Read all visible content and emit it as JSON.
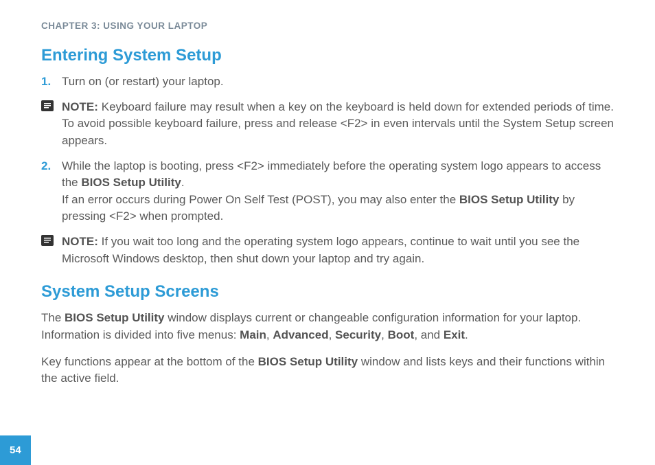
{
  "chapter": "CHAPTER 3: USING YOUR LAPTOP",
  "heading1": "Entering System Setup",
  "step1": {
    "num": "1.",
    "text": "Turn on (or restart) your laptop."
  },
  "note1": {
    "label": "NOTE:",
    "text": " Keyboard failure may result when a key on the keyboard is held down for extended periods of time. To avoid possible keyboard failure, press and release <F2> in even intervals until the System Setup screen appears."
  },
  "step2": {
    "num": "2.",
    "part_a_pre": "While the laptop is booting, press <F2> immediately before the operating system logo appears to access the ",
    "part_a_bold": "BIOS Setup Utility",
    "part_a_post": ".",
    "part_b_pre": "If an error occurs during Power On Self Test (POST), you may also enter the ",
    "part_b_bold": "BIOS Setup Utility",
    "part_b_post": " by pressing <F2> when prompted."
  },
  "note2": {
    "label": "NOTE:",
    "text": " If you wait too long and the operating system logo appears, continue to wait until you see the Microsoft Windows desktop, then shut down your laptop and try again."
  },
  "heading2": "System Setup Screens",
  "para1": {
    "pre": "The ",
    "bold1": "BIOS Setup Utility",
    "mid": " window displays current or changeable configuration information for your laptop. Information is divided into five menus: ",
    "m1": "Main",
    "c1": ", ",
    "m2": "Advanced",
    "c2": ", ",
    "m3": "Security",
    "c3": ", ",
    "m4": "Boot",
    "c4": ", and ",
    "m5": "Exit",
    "post": "."
  },
  "para2": {
    "pre": "Key functions appear at the bottom of the ",
    "bold1": "BIOS Setup Utility",
    "post": " window and lists keys and their functions within the active field."
  },
  "page_number": "54"
}
